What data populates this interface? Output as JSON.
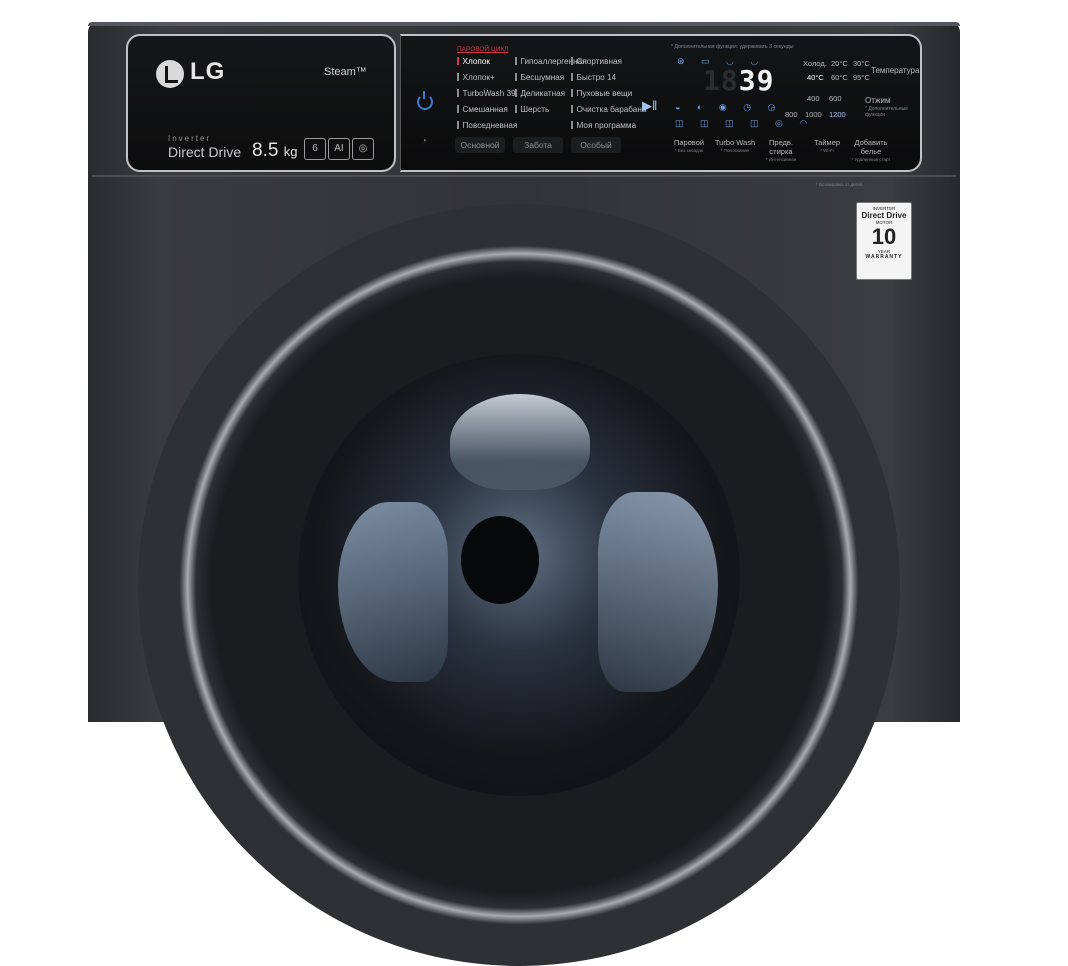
{
  "brand": {
    "logo_text": "LG",
    "steam_label": "Steam™",
    "inverter_label": "Inverter",
    "motor_label": "Direct Drive",
    "capacity": "8.5",
    "capacity_unit": "kg",
    "badges": [
      "6",
      "AI",
      "◎"
    ]
  },
  "left_controls": {
    "power_icon": "power-icon",
    "smart_diagnosis_icon": "smart-diagnosis-icon"
  },
  "programs": {
    "header": "ПАРОВОЙ ЦИКЛ",
    "col1": [
      "Хлопок",
      "Хлопок+",
      "TurboWash 39",
      "Смешанная",
      "Повседневная"
    ],
    "col2": [
      "Гипоаллергенная",
      "Бесшумная",
      "Деликатная",
      "Шерсть"
    ],
    "col3": [
      "Спортивная",
      "Быстро 14",
      "Пуховые вещи",
      "Очистка барабана",
      "Моя программа"
    ],
    "active": "Хлопок",
    "buttons": [
      "Основной",
      "Забота",
      "Особый"
    ],
    "start_pause_icon": "play-pause-icon"
  },
  "display": {
    "note": "* Дополнительная функция: удерживать 3 секунды",
    "dim_digits": "18",
    "time_digits": "39",
    "accent_color": "#6b9ee0"
  },
  "temperature": {
    "label": "Температура",
    "values": [
      "Холод.",
      "20°C",
      "30°C",
      "40°C",
      "60°C",
      "95°C"
    ],
    "selected": "40°C"
  },
  "spin": {
    "label": "Отжим",
    "sublabel": "* Дополнительные функции",
    "values": [
      "400",
      "600",
      "800",
      "1000",
      "1200"
    ],
    "selected": "1200"
  },
  "function_buttons": [
    {
      "label": "Паровой",
      "sub": "* Без складок"
    },
    {
      "label": "Turbo Wash",
      "sub": "* Полоскание"
    },
    {
      "label": "Предв. стирка",
      "sub": "* Интенсивная"
    },
    {
      "label": "Таймер",
      "sub": "* Wi-Fi"
    },
    {
      "label": "Добавить белье",
      "sub": "* Удаленный старт"
    }
  ],
  "function_note": "* Блокировка от детей",
  "warranty": {
    "line1": "INVERTER",
    "line2": "Direct Drive",
    "line3": "MOTOR",
    "years": "10",
    "years_label": "YEAR",
    "label": "WARRANTY"
  }
}
